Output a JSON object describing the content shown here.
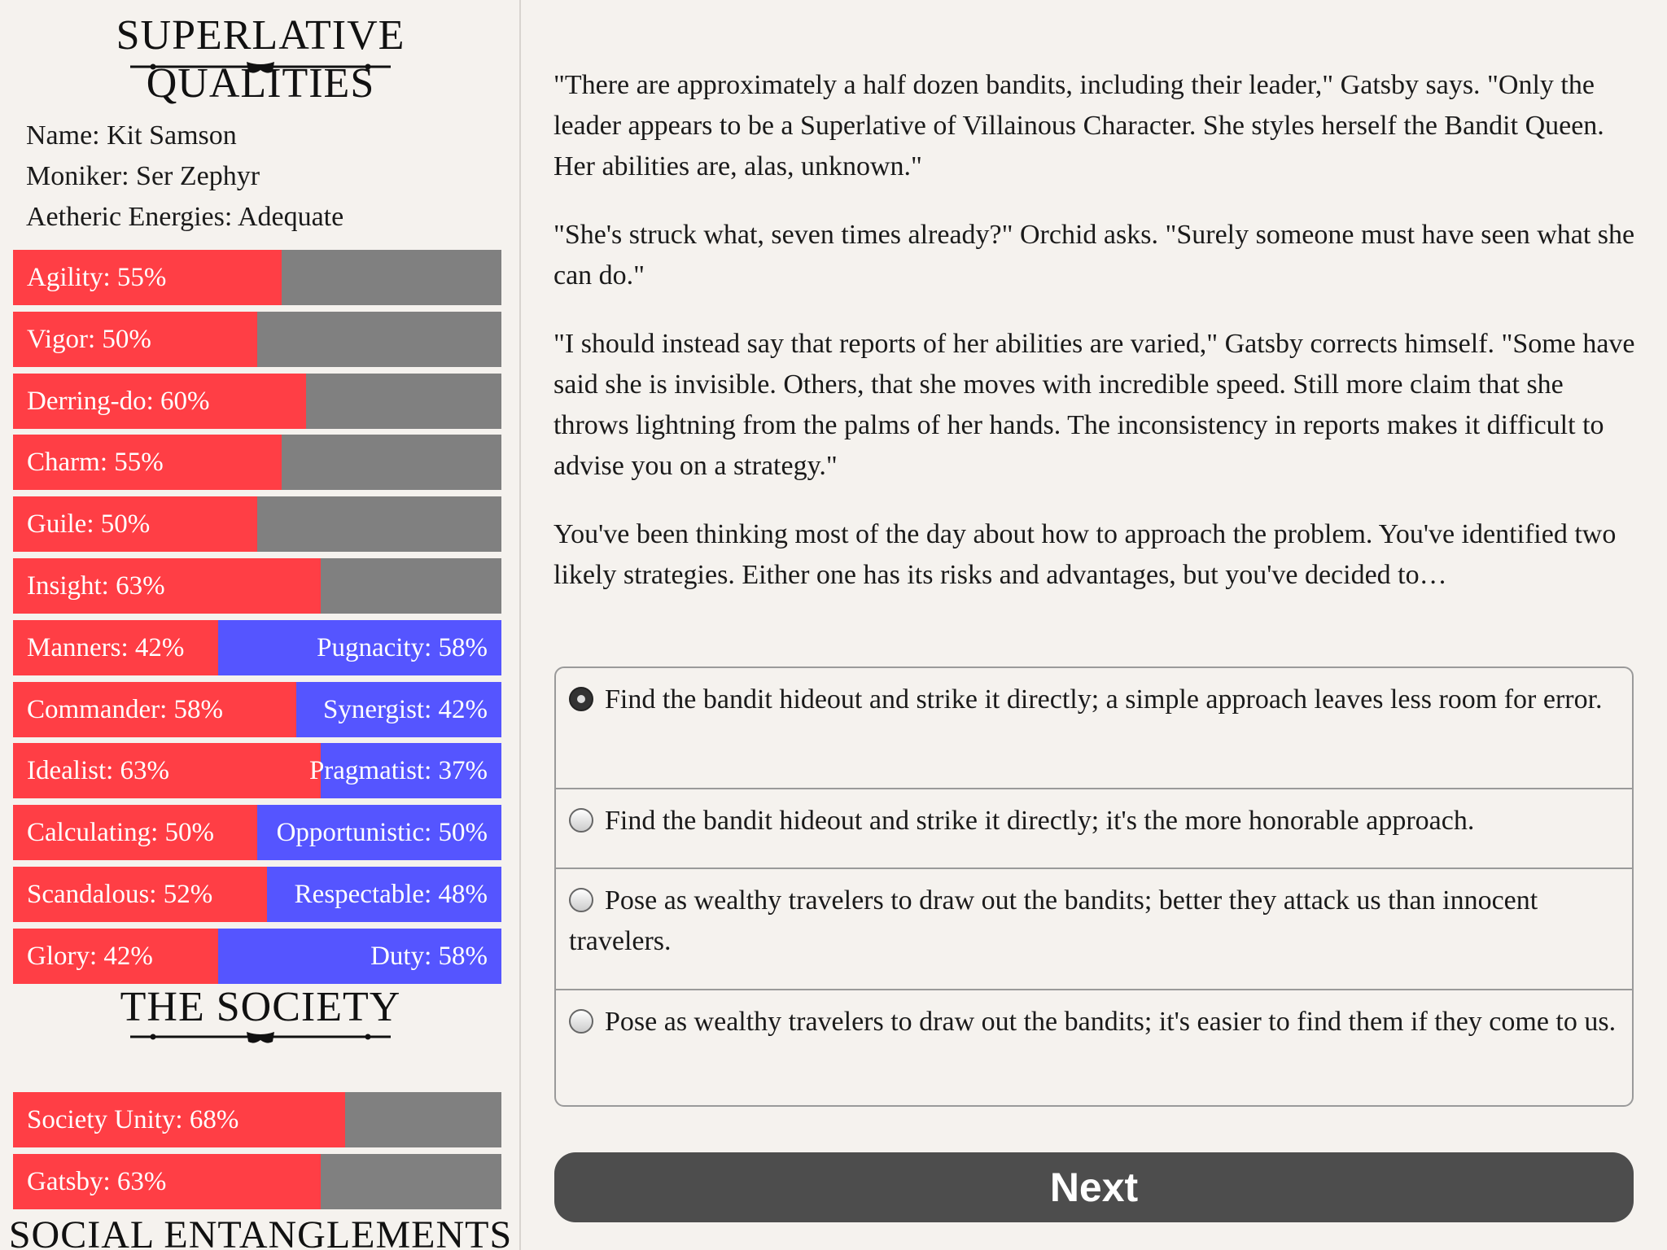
{
  "sidebar": {
    "title": "SUPERLATIVE QUALITIES",
    "name": "Name: Kit Samson",
    "moniker": "Moniker: Ser Zephyr",
    "energies": "Aetheric Energies: Adequate",
    "stats": [
      {
        "label": "Agility: 55%",
        "value": 55
      },
      {
        "label": "Vigor: 50%",
        "value": 50
      },
      {
        "label": "Derring-do: 60%",
        "value": 60
      },
      {
        "label": "Charm: 55%",
        "value": 55
      },
      {
        "label": "Guile: 50%",
        "value": 50
      },
      {
        "label": "Insight: 63%",
        "value": 63
      }
    ],
    "opposed": [
      {
        "left": "Manners: 42%",
        "right": "Pugnacity: 58%",
        "value": 42
      },
      {
        "left": "Commander: 58%",
        "right": "Synergist: 42%",
        "value": 58
      },
      {
        "left": "Idealist: 63%",
        "right": "Pragmatist: 37%",
        "value": 63
      },
      {
        "left": "Calculating: 50%",
        "right": "Opportunistic: 50%",
        "value": 50
      },
      {
        "left": "Scandalous: 52%",
        "right": "Respectable: 48%",
        "value": 52
      },
      {
        "left": "Glory: 42%",
        "right": "Duty: 58%",
        "value": 42
      }
    ],
    "society_title": "THE SOCIETY",
    "society": [
      {
        "label": "Society Unity: 68%",
        "value": 68
      },
      {
        "label": "Gatsby: 63%",
        "value": 63
      }
    ],
    "entanglements_title": "SOCIAL ENTANGLEMENTS",
    "colors": {
      "fill": "#ff3e45",
      "empty": "#808080",
      "opposed": "#5555ff"
    }
  },
  "story": {
    "paragraphs": [
      "\"There are approximately a half dozen bandits, including their leader,\" Gatsby says. \"Only the leader appears to be a Superlative of Villainous Character. She styles herself the Bandit Queen. Her abilities are, alas, unknown.\"",
      "\"She's struck what, seven times already?\" Orchid asks. \"Surely someone must have seen what she can do.\"",
      "\"I should instead say that reports of her abilities are varied,\" Gatsby corrects himself. \"Some have said she is invisible. Others, that she moves with incredible speed. Still more claim that she throws lightning from the palms of her hands. The inconsistency in reports makes it difficult to advise you on a strategy.\"",
      "You've been thinking most of the day about how to approach the problem. You've identified two likely strategies. Either one has its risks and advantages, but you've decided to…"
    ],
    "choices": [
      {
        "text": "Find the bandit hideout and strike it directly; a simple approach leaves less room for error.",
        "selected": true
      },
      {
        "text": "Find the bandit hideout and strike it directly; it's the more honorable approach.",
        "selected": false
      },
      {
        "text": "Pose as wealthy travelers to draw out the bandits; better they attack us than innocent travelers.",
        "selected": false
      },
      {
        "text": "Pose as wealthy travelers to draw out the bandits; it's easier to find them if they come to us.",
        "selected": false
      }
    ],
    "next_label": "Next"
  }
}
